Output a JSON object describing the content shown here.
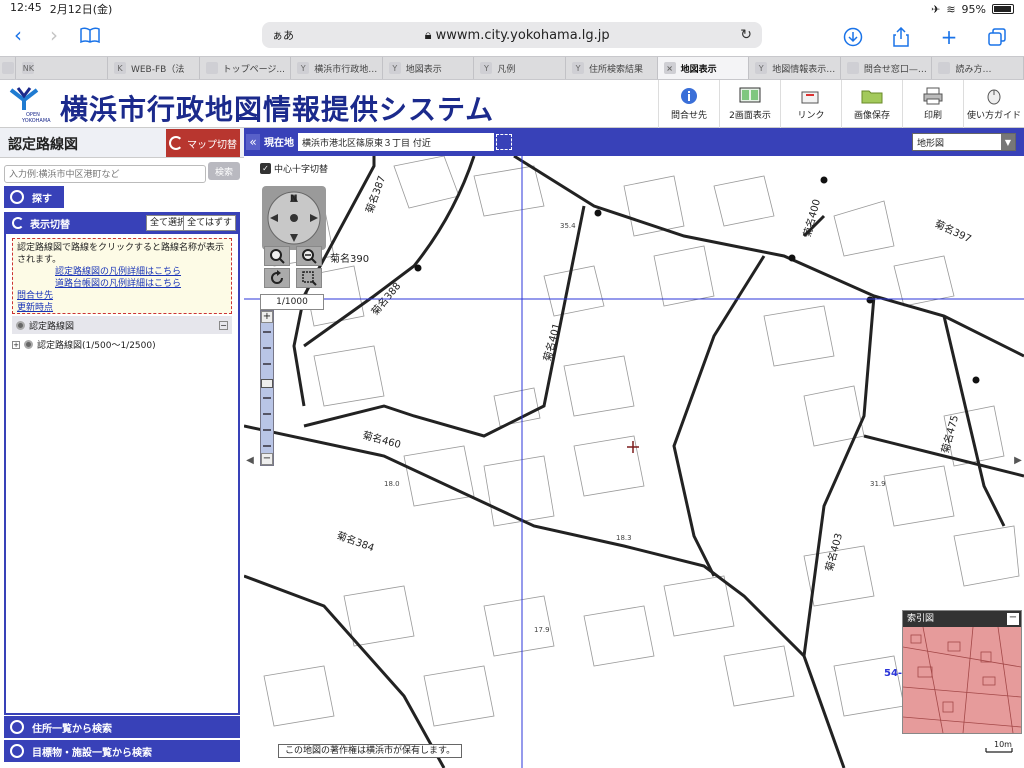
{
  "status_bar": {
    "time": "12:45",
    "date": "2月12日(金)",
    "battery": "95%"
  },
  "browser": {
    "aa": "ぁあ",
    "url": "wwwm.city.yokohama.lg.jp",
    "tabs": [
      {
        "label": "",
        "fav": ""
      },
      {
        "label": "",
        "fav": "NK"
      },
      {
        "label": "WEB-FB（法",
        "fav": "K"
      },
      {
        "label": "トップページ...",
        "fav": ""
      },
      {
        "label": "横浜市行政地…",
        "fav": "Y"
      },
      {
        "label": "地図表示",
        "fav": "Y"
      },
      {
        "label": "凡例",
        "fav": "Y"
      },
      {
        "label": "住所検索結果",
        "fav": "Y"
      },
      {
        "label": "地図表示",
        "fav": "×",
        "active": true
      },
      {
        "label": "地図情報表示…",
        "fav": "Y"
      },
      {
        "label": "問合せ窓口—…",
        "fav": ""
      },
      {
        "label": "読み方…",
        "fav": ""
      }
    ]
  },
  "header": {
    "logo_text_1": "OPEN",
    "logo_text_2": "YOKOHAMA",
    "title": "横浜市行政地図情報提供システム",
    "buttons": [
      {
        "label": "問合せ先",
        "icon": "info-icon"
      },
      {
        "label": "2画面表示",
        "icon": "dual-screen-icon"
      },
      {
        "label": "リンク",
        "icon": "link-icon"
      },
      {
        "label": "画像保存",
        "icon": "folder-icon"
      },
      {
        "label": "印刷",
        "icon": "printer-icon"
      },
      {
        "label": "使い方ガイド",
        "icon": "mouse-icon"
      }
    ]
  },
  "left_panel": {
    "title": "認定路線図",
    "map_switch": "マップ切替",
    "search_placeholder": "入力例:横浜市中区港町など",
    "search_button": "検索",
    "find": "探す",
    "display_toggle": "表示切替",
    "select_all": "全て選択",
    "deselect_all": "全てはずす",
    "notice_text": "認定路線図で路線をクリックすると路線名称が表示されます。",
    "link_legend_route": "認定路線図の凡例詳細はこちら",
    "link_legend_road": "道路台帳図の凡例詳細はこちら",
    "link_contact": "問合せ先",
    "link_updated": "更新時点",
    "layer_group": "認定路線図",
    "layer_item": "認定路線図(1/500〜1/2500)",
    "search_by_address": "住所一覧から検索",
    "search_by_facility": "目標物・施設一覧から検索"
  },
  "map": {
    "current_location_label": "現在地",
    "current_location": "横浜市港北区篠原東３丁目 付近",
    "basemap": "地形図",
    "center_cross_toggle": "中心十字切替",
    "scale": "1/1000",
    "compass_n": "N",
    "index_map_title": "索引図",
    "copyright": "この地図の著作権は横浜市が保有します。",
    "scalebar_label": "10m",
    "route_labels": [
      "菊名387",
      "菊名390",
      "菊名388",
      "菊名401",
      "菊名400",
      "菊名397",
      "菊名460",
      "菊名384",
      "菊名475",
      "菊名403"
    ],
    "elevations": [
      "35.4",
      "18.3",
      "17.9",
      "31.9",
      "18.0"
    ],
    "index_label": "54-"
  }
}
